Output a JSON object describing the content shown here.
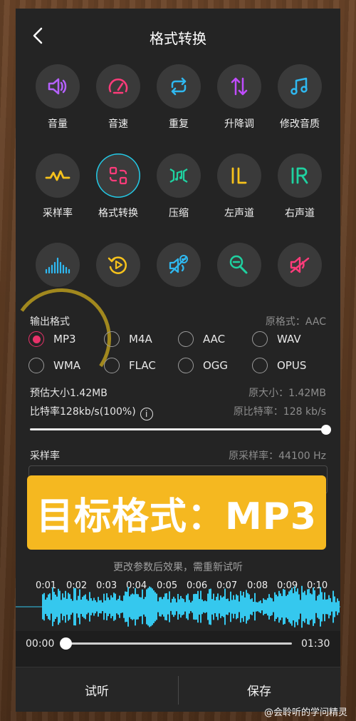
{
  "header": {
    "title": "格式转换"
  },
  "tools": [
    {
      "label": "音量",
      "icon": "volume-icon",
      "color": "#b561ff"
    },
    {
      "label": "音速",
      "icon": "speedometer-icon",
      "color": "#ff3b7a"
    },
    {
      "label": "重复",
      "icon": "repeat-icon",
      "color": "#2fb8f0"
    },
    {
      "label": "升降调",
      "icon": "pitch-arrows-icon",
      "color": "#c04cff"
    },
    {
      "label": "修改音质",
      "icon": "music-note-icon",
      "color": "#2fb8f0"
    },
    {
      "label": "采样率",
      "icon": "waveform-pulse-icon",
      "color": "#f6c21c"
    },
    {
      "label": "格式转换",
      "icon": "format-convert-icon",
      "color": "#ff3b7a"
    },
    {
      "label": "压缩",
      "icon": "compress-icon",
      "color": "#1fd1a0"
    },
    {
      "label": "左声道",
      "icon": "left-channel-icon",
      "color": "#f6c21c"
    },
    {
      "label": "右声道",
      "icon": "right-channel-icon",
      "color": "#1fd1a0"
    },
    {
      "label": "",
      "icon": "spectrum-bars-icon",
      "color": "#2fb8f0"
    },
    {
      "label": "",
      "icon": "reverse-play-icon",
      "color": "#f6c21c"
    },
    {
      "label": "",
      "icon": "noise-reduce-icon",
      "color": "#2fb8f0"
    },
    {
      "label": "",
      "icon": "voice-record-icon",
      "color": "#1fd1a0"
    },
    {
      "label": "",
      "icon": "mute-icon",
      "color": "#ff3b7a"
    }
  ],
  "output": {
    "label": "输出格式",
    "original": "原格式：AAC",
    "formats": [
      {
        "label": "MP3",
        "selected": true
      },
      {
        "label": "M4A",
        "selected": false
      },
      {
        "label": "AAC",
        "selected": false
      },
      {
        "label": "WAV",
        "selected": false
      },
      {
        "label": "WMA",
        "selected": false
      },
      {
        "label": "FLAC",
        "selected": false
      },
      {
        "label": "OGG",
        "selected": false
      },
      {
        "label": "OPUS",
        "selected": false
      }
    ]
  },
  "size": {
    "estimate": "预估大小1.42MB",
    "original": "原大小：1.42MB"
  },
  "bitrate": {
    "label": "比特率128kb/s(100%)",
    "info_icon": "i",
    "original": "原比特率：128 kb/s",
    "slider_percent": 100
  },
  "sample_rate": {
    "label": "采样率",
    "original": "原采样率：44100 Hz"
  },
  "banner": {
    "text": "目标格式：MP3"
  },
  "hint": "更改参数后效果，需重新试听",
  "timeline": [
    "0:01",
    "0:02",
    "0:03",
    "0:04",
    "0:05",
    "0:06",
    "0:07",
    "0:08",
    "0:09",
    "0:10"
  ],
  "player": {
    "current": "00:00",
    "total": "01:30",
    "progress": 0
  },
  "actions": {
    "preview": "试听",
    "save": "保存"
  },
  "watermark": "@会聆听的学问精灵",
  "colors": {
    "accent": "#e8326a",
    "wave": "#35c8ee",
    "banner": "#f5b820"
  }
}
